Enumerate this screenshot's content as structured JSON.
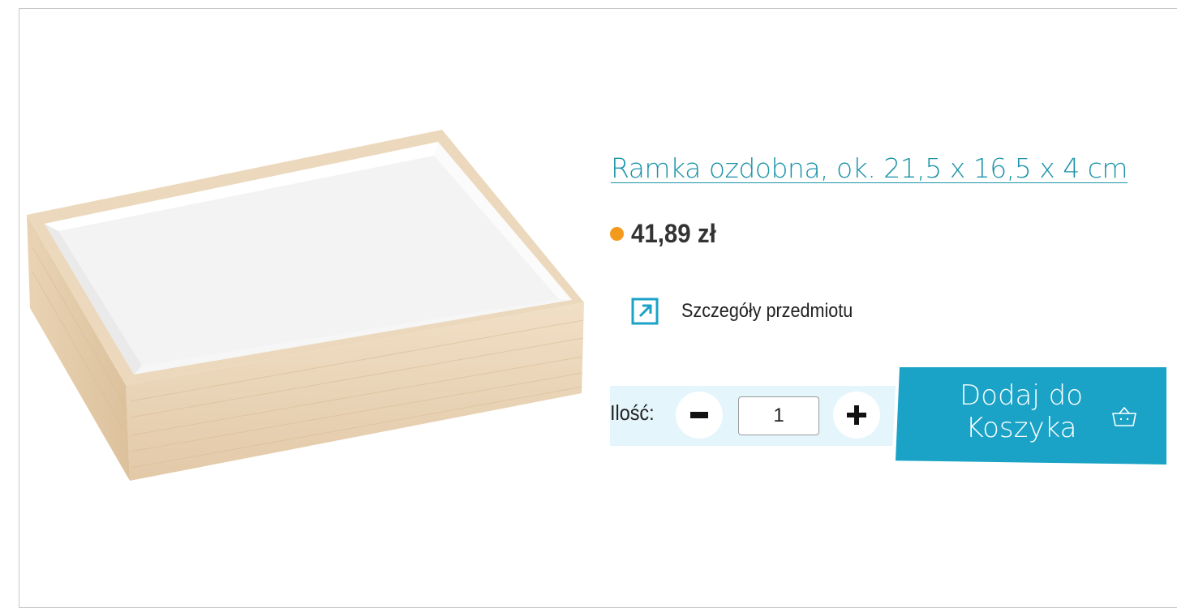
{
  "product": {
    "title": "Ramka ozdobna, ok. 21,5 x 16,5 x 4 cm",
    "price": "41,89 zł",
    "details_link": "Szczegóły przedmiotu"
  },
  "quantity": {
    "label": "Ilość:",
    "value": "1"
  },
  "cart": {
    "line1": "Dodaj do",
    "line2": "Koszyka"
  },
  "colors": {
    "accent": "#1aa3c6",
    "link": "#1b93a8",
    "price_dot": "#f39a1c",
    "qty_background": "#e4f5fb"
  },
  "icons": {
    "details": "external-link-arrow-icon",
    "minus": "minus-icon",
    "plus": "plus-icon",
    "cart": "basket-icon"
  }
}
